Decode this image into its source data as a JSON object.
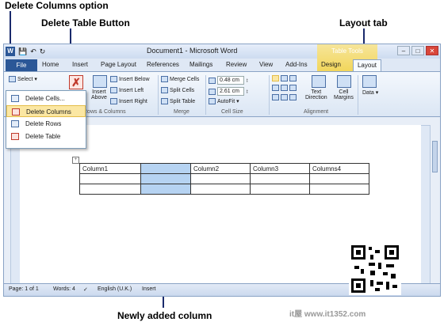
{
  "callouts": {
    "delete_columns": "Delete Columns option",
    "delete_table": "Delete Table Button",
    "layout_tab": "Layout tab",
    "new_column": "Newly added column"
  },
  "window": {
    "title": "Document1 - Microsoft Word",
    "contextual_group": "Table Tools"
  },
  "tabs": [
    "File",
    "Home",
    "Insert",
    "Page Layout",
    "References",
    "Mailings",
    "Review",
    "View",
    "Add-Ins",
    "Design",
    "Layout"
  ],
  "ribbon": {
    "select": "Select",
    "delete_label": "Delete",
    "insert_above": [
      "Insert",
      "Above"
    ],
    "insert_below": "Insert Below",
    "insert_left": "Insert Left",
    "insert_right": "Insert Right",
    "rows_columns": "Rows & Columns",
    "merge_cells": "Merge Cells",
    "split_cells": "Split Cells",
    "split_table": "Split Table",
    "merge_group": "Merge",
    "height": "0.48 cm",
    "width": "2.61 cm",
    "autofit": "AutoFit",
    "cell_size": "Cell Size",
    "text_direction": [
      "Text",
      "Direction"
    ],
    "cell_margins": [
      "Cell",
      "Margins"
    ],
    "alignment": "Alignment",
    "data": "Data"
  },
  "delete_menu": [
    "Delete Cells...",
    "Delete Columns",
    "Delete Rows",
    "Delete Table"
  ],
  "table": {
    "header": [
      "Column1",
      "",
      "Column2",
      "Column3",
      "Columns4"
    ]
  },
  "status": {
    "page": "Page: 1 of 1",
    "words": "Words: 4",
    "language": "English (U.K.)",
    "mode": "Insert"
  },
  "watermark": "it屋 www.it1352.com",
  "colors": {
    "file_tab": "#2b5797",
    "contextual_tab": "#f2d65b",
    "highlight_column": "#b6d3f2",
    "callout_arrow": "#1a2a6c"
  }
}
